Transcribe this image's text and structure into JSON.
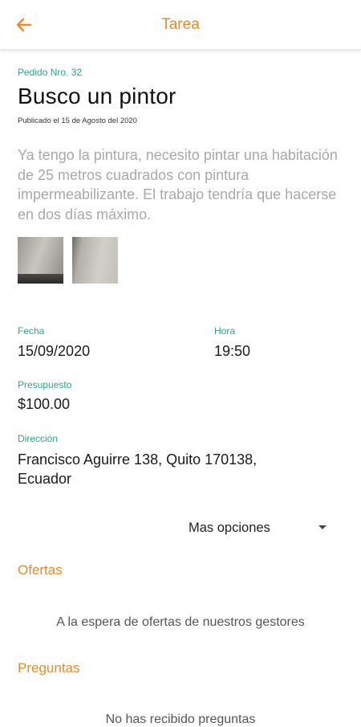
{
  "header": {
    "title": "Tarea",
    "back_icon": "arrow-left-icon",
    "accent_color": "#e8892a"
  },
  "task": {
    "order_number": "Pedido Nro. 32",
    "title": "Busco un pintor",
    "published": "Publicado el 15 de Agosto del 2020",
    "description": "Ya tengo la pintura, necesito pintar una habitación de 25 metros cuadrados con pintura impermeabilizante. El trabajo tendría que hacerse en dos días máximo.",
    "photos_count": 2
  },
  "details": {
    "date_label": "Fecha",
    "date_value": "15/09/2020",
    "time_label": "Hora",
    "time_value": "19:50",
    "budget_label": "Presupuesto",
    "budget_value": "$100.00",
    "address_label": "Dirección",
    "address_value": "Francisco Aguirre 138, Quito 170138, Ecuador",
    "label_color": "#2aa58f"
  },
  "more_options": {
    "label": "Mas opciones",
    "icon": "caret-down-icon"
  },
  "offers": {
    "title": "Ofertas",
    "empty_message": "A la espera de ofertas de nuestros gestores"
  },
  "questions": {
    "title": "Preguntas",
    "empty_message": "No has recibido preguntas"
  }
}
